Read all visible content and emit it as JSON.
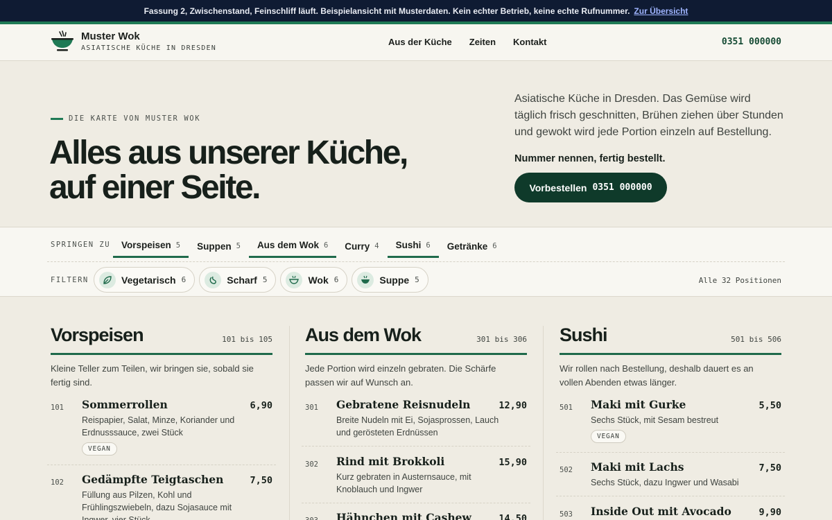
{
  "banner": {
    "text": "Fassung 2, Zwischenstand, Feinschliff läuft. Beispielansicht mit Musterdaten. Kein echter Betrieb, keine echte Rufnummer.",
    "link": "Zur Übersicht"
  },
  "header": {
    "brand_name": "Muster Wok",
    "brand_sub": "ASIATISCHE KÜCHE IN DRESDEN",
    "nav": [
      "Aus der Küche",
      "Zeiten",
      "Kontakt"
    ],
    "phone": "0351 000000"
  },
  "hero": {
    "eyebrow": "DIE KARTE VON MUSTER WOK",
    "title": "Alles aus unserer Küche, auf einer Seite.",
    "text": "Asiatische Küche in Dresden. Das Gemüse wird täglich frisch geschnitten, Brühen ziehen über Stunden und gewokt wird jede Portion einzeln auf Bestellung.",
    "strong": "Nummer nennen, fertig bestellt.",
    "button_label": "Vorbestellen",
    "button_number": "0351 000000"
  },
  "jump": {
    "label": "SPRINGEN ZU",
    "categories": [
      {
        "name": "Vorspeisen",
        "count": "5"
      },
      {
        "name": "Suppen",
        "count": "5"
      },
      {
        "name": "Aus dem Wok",
        "count": "6"
      },
      {
        "name": "Curry",
        "count": "4"
      },
      {
        "name": "Sushi",
        "count": "6"
      },
      {
        "name": "Getränke",
        "count": "6"
      }
    ]
  },
  "filter": {
    "label": "FILTERN",
    "chips": [
      {
        "name": "Vegetarisch",
        "count": "6",
        "icon": "leaf-icon"
      },
      {
        "name": "Scharf",
        "count": "5",
        "icon": "chili-icon"
      },
      {
        "name": "Wok",
        "count": "6",
        "icon": "wok-icon"
      },
      {
        "name": "Suppe",
        "count": "5",
        "icon": "soup-bowl-icon"
      }
    ],
    "all": "Alle 32 Positionen"
  },
  "columns": [
    {
      "title": "Vorspeisen",
      "range": "101 bis 105",
      "intro": "Kleine Teller zum Teilen, wir bringen sie, sobald sie fertig sind.",
      "items": [
        {
          "no": "101",
          "name": "Sommerrollen",
          "price": "6,90",
          "desc": "Reispapier, Salat, Minze, Koriander und Erdnusssauce, zwei Stück",
          "tag": "VEGAN"
        },
        {
          "no": "102",
          "name": "Gedämpfte Teigtaschen",
          "price": "7,50",
          "desc": "Füllung aus Pilzen, Kohl und Frühlingszwiebeln, dazu Sojasauce mit Ingwer, vier Stück"
        }
      ]
    },
    {
      "title": "Aus dem Wok",
      "range": "301 bis 306",
      "intro": "Jede Portion wird einzeln gebraten. Die Schärfe passen wir auf Wunsch an.",
      "items": [
        {
          "no": "301",
          "name": "Gebratene Reisnudeln",
          "price": "12,90",
          "desc": "Breite Nudeln mit Ei, Sojasprossen, Lauch und gerösteten Erdnüssen"
        },
        {
          "no": "302",
          "name": "Rind mit Brokkoli",
          "price": "15,90",
          "desc": "Kurz gebraten in Austernsauce, mit Knoblauch und Ingwer"
        },
        {
          "no": "303",
          "name": "Hähnchen mit Cashew",
          "price": "14,50",
          "desc": ""
        }
      ]
    },
    {
      "title": "Sushi",
      "range": "501 bis 506",
      "intro": "Wir rollen nach Bestellung, deshalb dauert es an vollen Abenden etwas länger.",
      "items": [
        {
          "no": "501",
          "name": "Maki mit Gurke",
          "price": "5,50",
          "desc": "Sechs Stück, mit Sesam bestreut",
          "tag": "VEGAN"
        },
        {
          "no": "502",
          "name": "Maki mit Lachs",
          "price": "7,50",
          "desc": "Sechs Stück, dazu Ingwer und Wasabi"
        },
        {
          "no": "503",
          "name": "Inside Out mit Avocado",
          "price": "9,90",
          "desc": ""
        }
      ]
    }
  ],
  "colors": {
    "accent": "#1f7a55",
    "dark_green": "#0f3a2a",
    "banner": "#0f1b33",
    "background": "#efece3"
  }
}
